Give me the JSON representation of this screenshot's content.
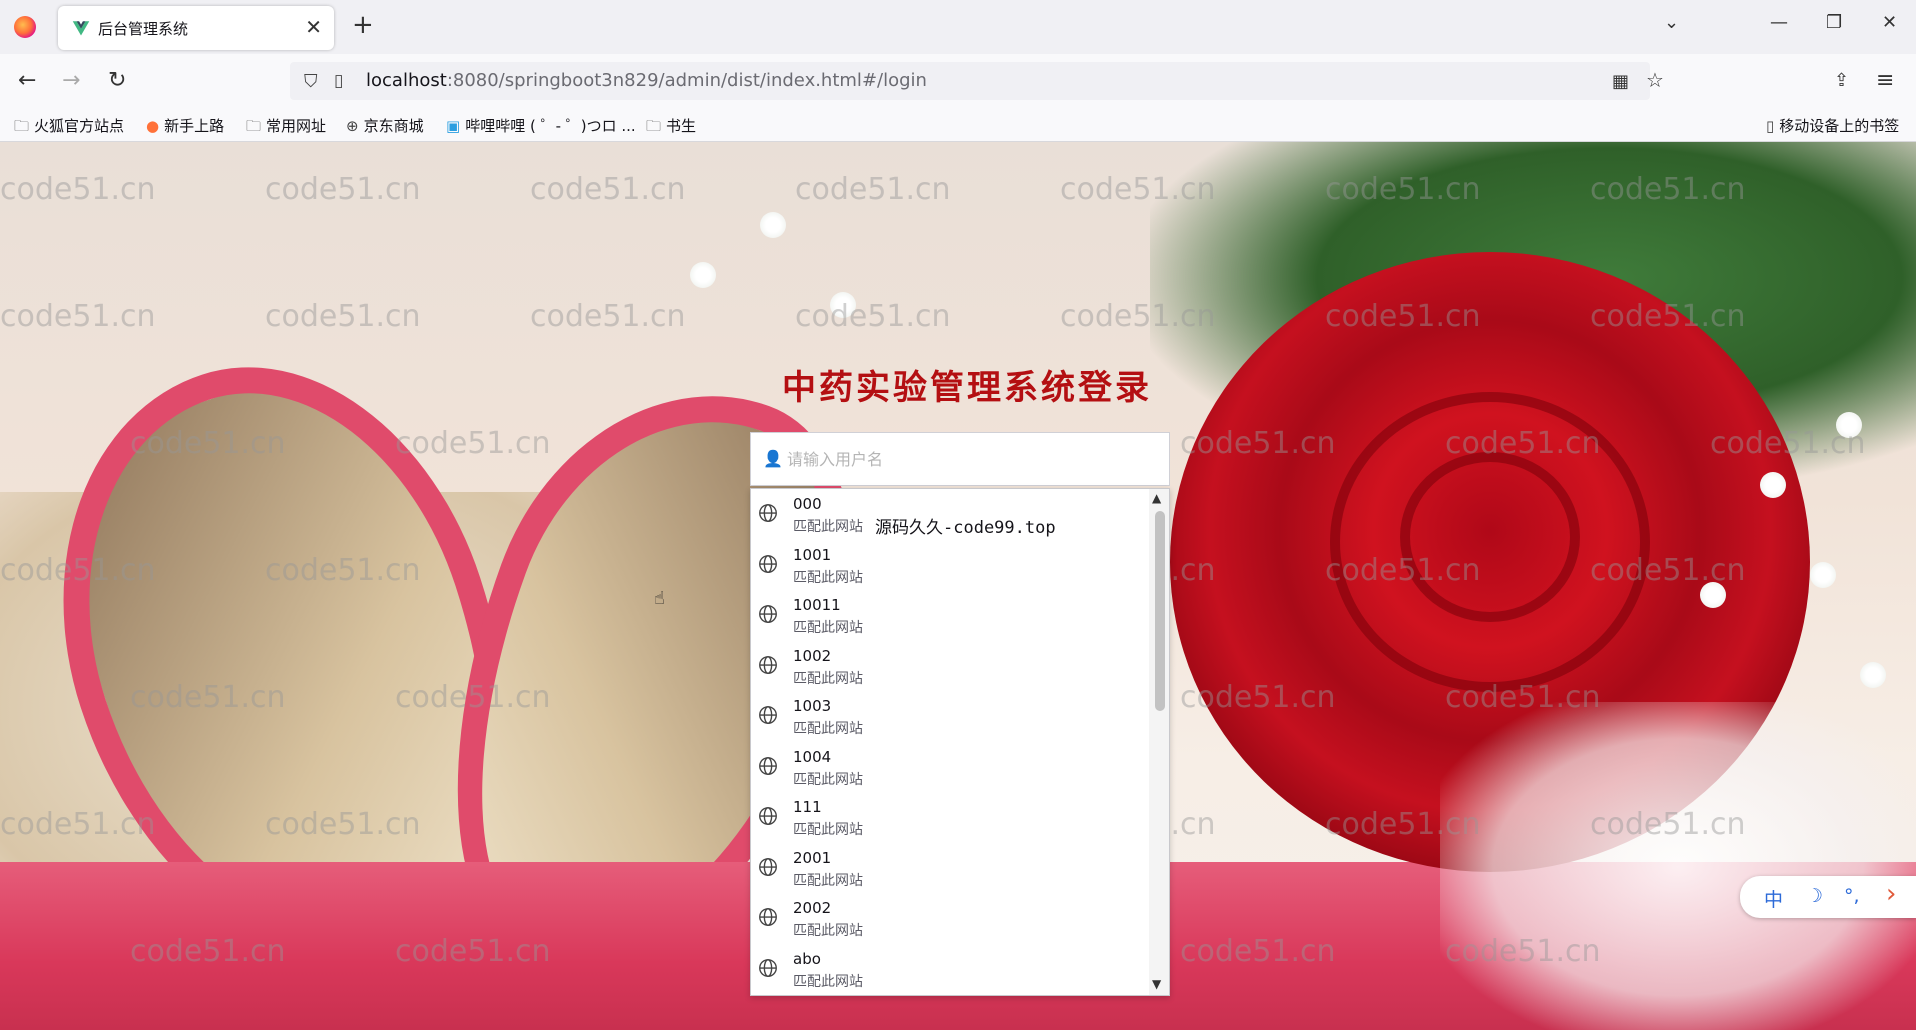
{
  "browser": {
    "tab_title": "后台管理系统",
    "url_host": "localhost",
    "url_rest": ":8080/springboot3n829/admin/dist/index.html#/login",
    "bookmarks": [
      "火狐官方站点",
      "新手上路",
      "常用网址",
      "京东商城",
      "哔哩哔哩 ( ゜- ゜)つロ ...",
      "书生"
    ],
    "mobile_bookmarks": "移动设备上的书签"
  },
  "login": {
    "title": "中药实验管理系统登录",
    "username_placeholder": "请输入用户名"
  },
  "autocomplete": {
    "items": [
      {
        "value": "000",
        "sub": "匹配此网站",
        "extra": "源码久久-code99.top"
      },
      {
        "value": "1001",
        "sub": "匹配此网站"
      },
      {
        "value": "10011",
        "sub": "匹配此网站"
      },
      {
        "value": "1002",
        "sub": "匹配此网站"
      },
      {
        "value": "1003",
        "sub": "匹配此网站"
      },
      {
        "value": "1004",
        "sub": "匹配此网站"
      },
      {
        "value": "111",
        "sub": "匹配此网站"
      },
      {
        "value": "2001",
        "sub": "匹配此网站"
      },
      {
        "value": "2002",
        "sub": "匹配此网站"
      },
      {
        "value": "abo",
        "sub": "匹配此网站"
      }
    ]
  },
  "ime": {
    "lang": "中",
    "moon": "☽",
    "punct": "°,",
    "arrow": "›"
  },
  "watermark": "code51.cn",
  "colors": {
    "title_red": "#b40f12",
    "ime_blue": "#2c6ad8"
  }
}
